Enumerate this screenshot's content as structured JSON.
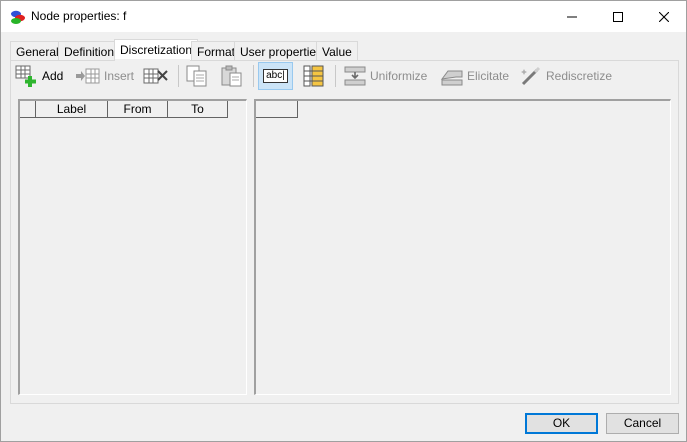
{
  "window": {
    "title": "Node properties: f"
  },
  "tabs": [
    {
      "label": "General"
    },
    {
      "label": "Definition"
    },
    {
      "label": "Discretization"
    },
    {
      "label": "Format"
    },
    {
      "label": "User properties"
    },
    {
      "label": "Value"
    }
  ],
  "active_tab": "Discretization",
  "toolbar": {
    "add_label": "Add",
    "insert_label": "Insert",
    "uniformize_label": "Uniformize",
    "elicitate_label": "Elicitate",
    "rediscretize_label": "Rediscretize",
    "label_mode_text": "abc|"
  },
  "left_grid": {
    "columns": [
      "Label",
      "From",
      "To"
    ]
  },
  "buttons": {
    "ok": "OK",
    "cancel": "Cancel"
  },
  "colors": {
    "accent": "#0078d7",
    "pressed_bg": "#cce4f7",
    "disabled_text": "#8d8d8d"
  }
}
